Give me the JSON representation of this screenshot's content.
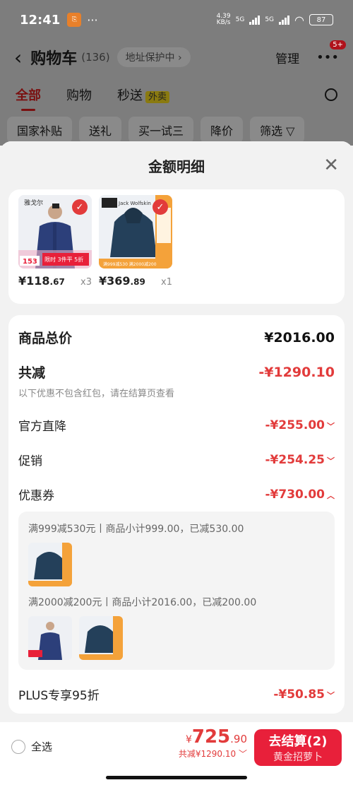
{
  "status": {
    "time": "12:41",
    "net_speed": "4.39",
    "net_unit": "KB/s",
    "sig1": "5G",
    "sig2": "5G",
    "battery": "87"
  },
  "header": {
    "title": "购物车",
    "count": "(136)",
    "address": "地址保护中 ›",
    "manage": "管理",
    "badge": "5+"
  },
  "tabs": [
    {
      "label": "全部"
    },
    {
      "label": "购物"
    },
    {
      "label": "秒送"
    }
  ],
  "waimai": "外卖",
  "chips": [
    "国家补贴",
    "送礼",
    "买一试三",
    "降价",
    "筛选 ▽"
  ],
  "sheet": {
    "title": "金额明细"
  },
  "products": [
    {
      "price_int": "¥118",
      "price_dec": ".67",
      "qty": "x3",
      "brand": "雅戈尔",
      "promo": "限时 3件平 5折",
      "tag": "153"
    },
    {
      "price_int": "¥369",
      "price_dec": ".89",
      "qty": "x1",
      "brand": "Jack Wolfskin",
      "promo": "满999减530 满2000减200"
    }
  ],
  "detail": {
    "total_label": "商品总价",
    "total_value": "¥2016.00",
    "reduce_label": "共减",
    "reduce_value": "-¥1290.10",
    "note": "以下优惠不包含红包，请在结算页查看",
    "official_label": "官方直降",
    "official_value": "-¥255.00",
    "promo_label": "促销",
    "promo_value": "-¥254.25",
    "coupon_label": "优惠券",
    "coupon_value": "-¥730.00",
    "coupon1": "满999减530元丨商品小计999.00，已减530.00",
    "coupon2": "满2000减200元丨商品小计2016.00，已减200.00",
    "plus_label": "PLUS专享95折",
    "plus_value": "-¥50.85"
  },
  "bottom": {
    "select_all": "全选",
    "currency": "¥",
    "amount_int": "725",
    "amount_dec": ".90",
    "saved": "共减¥1290.10",
    "checkout": "去结算(2)",
    "checkout_sub": "黄金招萝卜"
  },
  "colors": {
    "accent": "#e23b3b",
    "button": "#e8203a"
  }
}
